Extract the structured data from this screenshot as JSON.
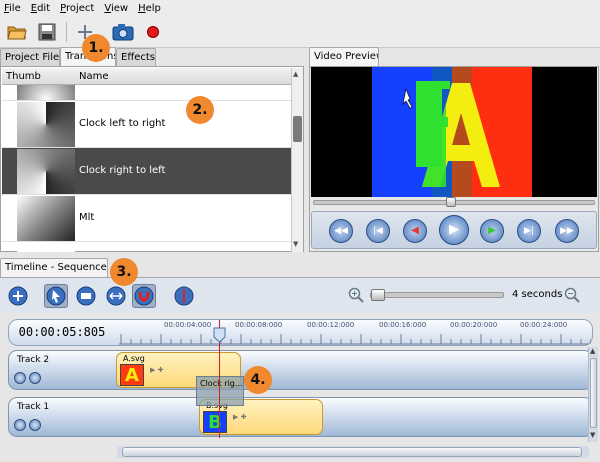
{
  "menu": [
    "File",
    "Edit",
    "Project",
    "View",
    "Help"
  ],
  "tabs_top": {
    "project_files": "Project Files",
    "transitions": "Transitions",
    "effects": "Effects",
    "video_preview": "Video Preview"
  },
  "transitions_list": {
    "col_thumb": "Thumb",
    "col_name": "Name",
    "rows": [
      {
        "name": ""
      },
      {
        "name": "Clock left to right"
      },
      {
        "name": "Clock right to left"
      },
      {
        "name": "Mlt"
      }
    ],
    "selected_row": "Clock right to left"
  },
  "timeline": {
    "tab_label": "Timeline - Sequence 1",
    "zoom_label": "4 seconds",
    "time_display": "00:00:05:805",
    "ruler_labels": [
      "00:00:04:000",
      "00:00:08:000",
      "00:00:12:000",
      "00:00:16:000",
      "00:00:20:000",
      "00:00:24:000"
    ],
    "tracks": [
      {
        "name": "Track 2",
        "clip": "A.svg",
        "letter": "A"
      },
      {
        "name": "Track 1",
        "clip": "B.svg",
        "letter": "B"
      }
    ],
    "transition_label": "Clock rig..."
  },
  "badges": [
    "1.",
    "2.",
    "3.",
    "4."
  ],
  "icons": {
    "open": "folder-open-icon",
    "save": "save-icon",
    "add": "add-icon",
    "snapshot": "camera-icon",
    "record": "record-icon"
  },
  "colors": {
    "badge": "#f0892d",
    "selection": "#4a4a4a",
    "timeline_bg": "#dfe5ee",
    "clip": "#ffd87a",
    "playhead": "#cc2020"
  }
}
